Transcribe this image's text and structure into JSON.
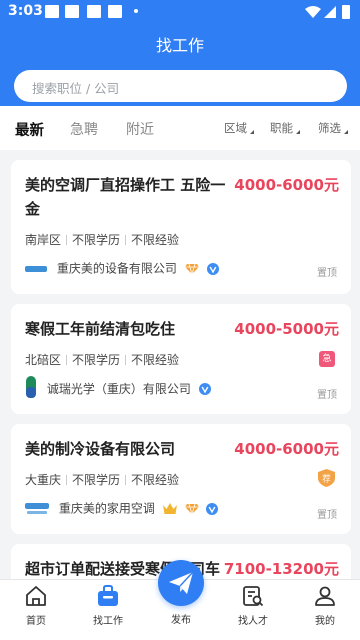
{
  "status": {
    "time": "3:03"
  },
  "header": {
    "title": "找工作"
  },
  "search": {
    "placeholder": "搜索职位 / 公司"
  },
  "tabs": [
    {
      "label": "最新",
      "active": true
    },
    {
      "label": "急聘",
      "active": false
    },
    {
      "label": "附近",
      "active": false
    }
  ],
  "filters": [
    {
      "label": "区域"
    },
    {
      "label": "职能"
    },
    {
      "label": "筛选"
    }
  ],
  "jobs": [
    {
      "title_line1": "美的空调厂直招操作工 五险一",
      "title_line2": "金",
      "salary": "4000-6000元",
      "district": "南岸区",
      "education": "不限学历",
      "experience": "不限经验",
      "company": "重庆美的设备有限公司",
      "pin": "置顶",
      "badges": [
        "diamond-icon",
        "verified-icon"
      ]
    },
    {
      "title_line1": "寒假工年前结清包吃住",
      "salary": "4000-5000元",
      "district": "北碚区",
      "education": "不限学历",
      "experience": "不限经验",
      "company": "诚瑞光学（重庆）有限公司",
      "pin": "置顶",
      "tag": "急",
      "badges": [
        "verified-icon"
      ]
    },
    {
      "title_line1": "美的制冷设备有限公司",
      "salary": "4000-6000元",
      "district": "大重庆",
      "education": "不限学历",
      "experience": "不限经验",
      "company": "重庆美的家用空调",
      "pin": "置顶",
      "tag": "荐",
      "badges": [
        "crown-icon",
        "diamond-icon",
        "verified-icon"
      ]
    },
    {
      "title_line1": "超市订单配送接受寒假工司车",
      "salary": "7100-13200元"
    }
  ],
  "nav": {
    "home": "首页",
    "jobs": "找工作",
    "publish": "发布",
    "talent": "找人才",
    "mine": "我的"
  },
  "colors": {
    "primary": "#2f7ef3",
    "salary": "#e9455d",
    "urgent": "#f0587a",
    "recommend": "#f3a347"
  }
}
